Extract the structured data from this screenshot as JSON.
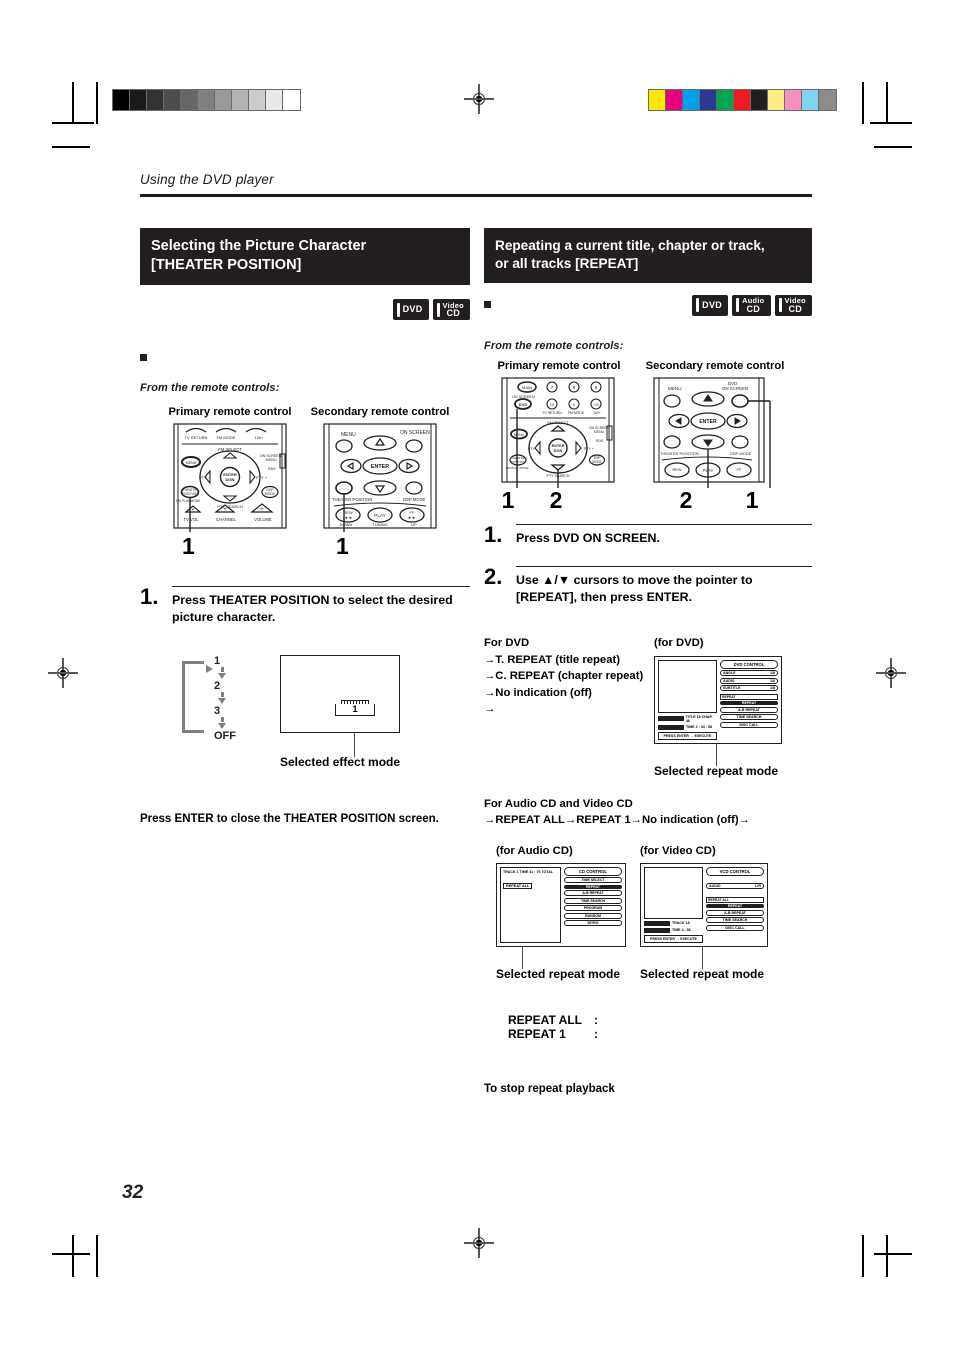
{
  "document": {
    "running_head": "Using the DVD player",
    "page_number": "32"
  },
  "print_marks": {
    "grayscale_strip": [
      "#000000",
      "#1a1a1a",
      "#333333",
      "#4d4d4d",
      "#666666",
      "#808080",
      "#999999",
      "#b3b3b3",
      "#cccccc",
      "#e8e8e8",
      "#ffffff"
    ],
    "color_strip": [
      "#ffe800",
      "#e6007e",
      "#00a0e9",
      "#2b3990",
      "#00a651",
      "#ed1c24",
      "#231f20",
      "#fced84",
      "#f58fbe",
      "#7fd4f4",
      "#8c8c8c"
    ]
  },
  "left_column": {
    "heading_line1": "Selecting the Picture Character",
    "heading_line2": "[THEATER POSITION]",
    "disc_icons": [
      {
        "name": "dvd-disc-icon",
        "line1": "DVD",
        "line2": ""
      },
      {
        "name": "video-cd-disc-icon",
        "line1": "Video",
        "line2": "CD"
      }
    ],
    "from_remote_label": "From the remote controls:",
    "remotes": [
      {
        "caption": "Primary remote control",
        "callout": "1"
      },
      {
        "caption": "Secondary remote control",
        "callout": "1"
      }
    ],
    "steps": [
      {
        "number": "1.",
        "text": "Press THEATER POSITION to select the desired picture character."
      }
    ],
    "cycle_diagram": {
      "items": [
        "1",
        "2",
        "3",
        "OFF"
      ]
    },
    "tv_screen": {
      "indicator_value": "1",
      "caption": "Selected effect mode"
    },
    "closing_note": "Press ENTER to close the THEATER POSITION screen."
  },
  "right_column": {
    "heading_line1": "Repeating a current title, chapter or track,",
    "heading_line2": "or all tracks [REPEAT]",
    "disc_icons": [
      {
        "name": "dvd-disc-icon",
        "line1": "DVD",
        "line2": ""
      },
      {
        "name": "audio-cd-disc-icon",
        "line1": "Audio",
        "line2": "CD"
      },
      {
        "name": "video-cd-disc-icon",
        "line1": "Video",
        "line2": "CD"
      }
    ],
    "from_remote_label": "From the remote controls:",
    "remotes": [
      {
        "caption": "Primary remote control",
        "callout_left": "1",
        "callout_right": "2"
      },
      {
        "caption": "Secondary remote control",
        "callout_left": "2",
        "callout_right": "1"
      }
    ],
    "steps": [
      {
        "number": "1.",
        "text": "Press DVD ON SCREEN."
      },
      {
        "number": "2.",
        "text": "Use ▲/▼ cursors to move the pointer to [REPEAT], then press ENTER."
      }
    ],
    "dvd_modes": {
      "title": "For DVD",
      "items": [
        "→T. REPEAT (title repeat)",
        "→C. REPEAT (chapter repeat)",
        "→No indication (off)",
        "→"
      ]
    },
    "dvd_screen": {
      "label": "(for DVD)",
      "osd_title": "DVD CONTROL",
      "rows": [
        {
          "label": "ANGLE",
          "value": "1/8"
        },
        {
          "label": "AUDIO",
          "value": "1/8"
        },
        {
          "label": "SUBTITLE",
          "value": "1/8"
        }
      ],
      "highlight": "REPEAT",
      "menu": [
        "REPEAT",
        "A-B REPEAT",
        "TIME SEARCH",
        "DISC CALL"
      ],
      "status_lines": [
        "TITLE 18  CHAP. 48",
        "TIME  2 : 34 : 58"
      ],
      "footer": "PRESS ENTER → EXECUTE",
      "caption": "Selected repeat mode"
    },
    "cd_modes": {
      "title": "For Audio CD and Video CD",
      "sequence": "→REPEAT ALL→REPEAT 1→No indication (off)→"
    },
    "audio_cd_screen": {
      "label": "(for Audio CD)",
      "osd_title": "CD CONTROL",
      "status_line": "TRACK   1   TIME  31 : 79 TOTAL",
      "indicator": "REPEAT ALL",
      "menu": [
        "TIME SELECT",
        "REPEAT",
        "A-B REPEAT",
        "TIME SEARCH",
        "PROGRAM",
        "RANDOM",
        "INTRO"
      ],
      "highlight": "REPEAT",
      "caption": "Selected repeat mode"
    },
    "video_cd_screen": {
      "label": "(for  Video CD)",
      "osd_title": "VCD CONTROL",
      "rows": [
        {
          "label": "AUDIO",
          "value": "L/R"
        }
      ],
      "indicator": "REPEAT ALL",
      "menu": [
        "REPEAT",
        "A-B REPEAT",
        "TIME SEARCH",
        "DISC CALL"
      ],
      "highlight": "REPEAT",
      "status_lines": [
        "TRACK 18",
        "TIME  4 : 56"
      ],
      "footer": "PRESS ENTER → EXECUTE",
      "caption": "Selected repeat mode"
    },
    "legend": [
      {
        "term": "REPEAT ALL",
        "colon": ":"
      },
      {
        "term": "REPEAT 1",
        "colon": ":"
      }
    ],
    "stop_note": "To stop repeat playback"
  }
}
